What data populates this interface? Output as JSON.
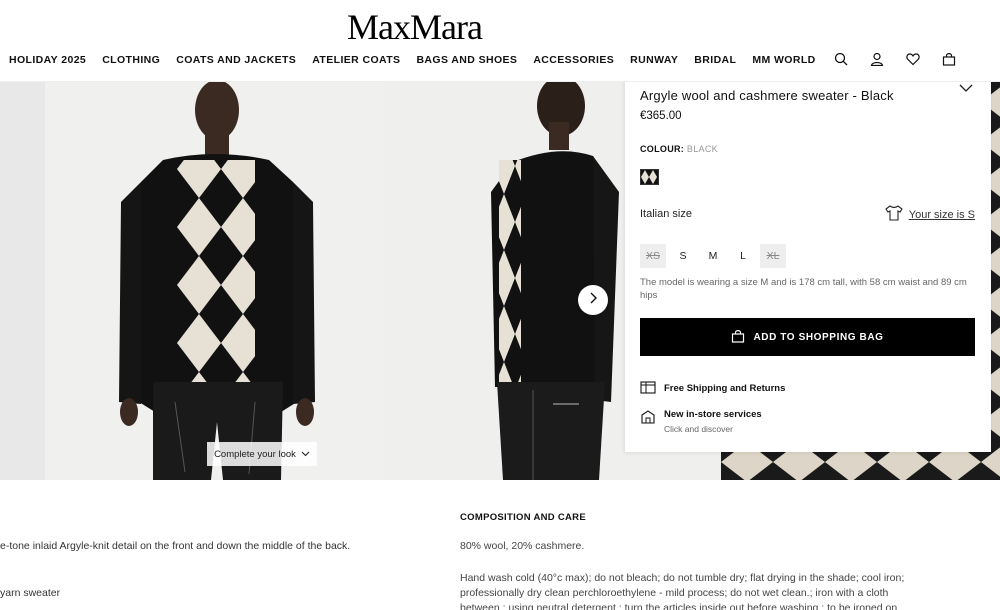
{
  "header": {
    "logo": "MaxMara",
    "nav": [
      "HOLIDAY 2025",
      "CLOTHING",
      "COATS AND JACKETS",
      "ATELIER COATS",
      "BAGS AND SHOES",
      "ACCESSORIES",
      "RUNWAY",
      "BRIDAL",
      "MM WORLD"
    ],
    "icons": [
      "search-icon",
      "user-icon",
      "heart-icon",
      "bag-icon"
    ]
  },
  "gallery": {
    "complete_look_label": "Complete your look"
  },
  "product": {
    "title": "Argyle wool and cashmere sweater - Black",
    "price": "€365.00",
    "colour_label": "COLOUR:",
    "colour_value": "BLACK",
    "size_label": "Italian size",
    "your_size_label": "Your size is S",
    "sizes": [
      {
        "label": "XS",
        "available": false
      },
      {
        "label": "S",
        "available": true
      },
      {
        "label": "M",
        "available": true
      },
      {
        "label": "L",
        "available": true
      },
      {
        "label": "XL",
        "available": false
      }
    ],
    "model_note": "The model is wearing a size M and is 178 cm tall, with 58 cm waist and 89 cm hips",
    "add_to_bag": "ADD TO SHOPPING BAG",
    "service1": "Free Shipping and Returns",
    "service2_title": "New in-store services",
    "service2_sub": "Click and discover"
  },
  "details": {
    "desc_line1": "e-tone inlaid Argyle-knit detail on the front and down the middle of the back.",
    "desc_line2": "yarn sweater",
    "composition_title": "COMPOSITION AND CARE",
    "composition": "80% wool, 20% cashmere.",
    "care": "Hand wash cold (40°c max); do not bleach; do not tumble dry; flat drying in the shade; cool iron; professionally dry clean perchloroethylene - mild process; do not wet clean.; iron with a cloth between ; using neutral detergent ; turn the articles inside out before washing ; to be ironed on"
  },
  "colors": {
    "accent": "#000000",
    "gallery_bg": "#ececec"
  }
}
